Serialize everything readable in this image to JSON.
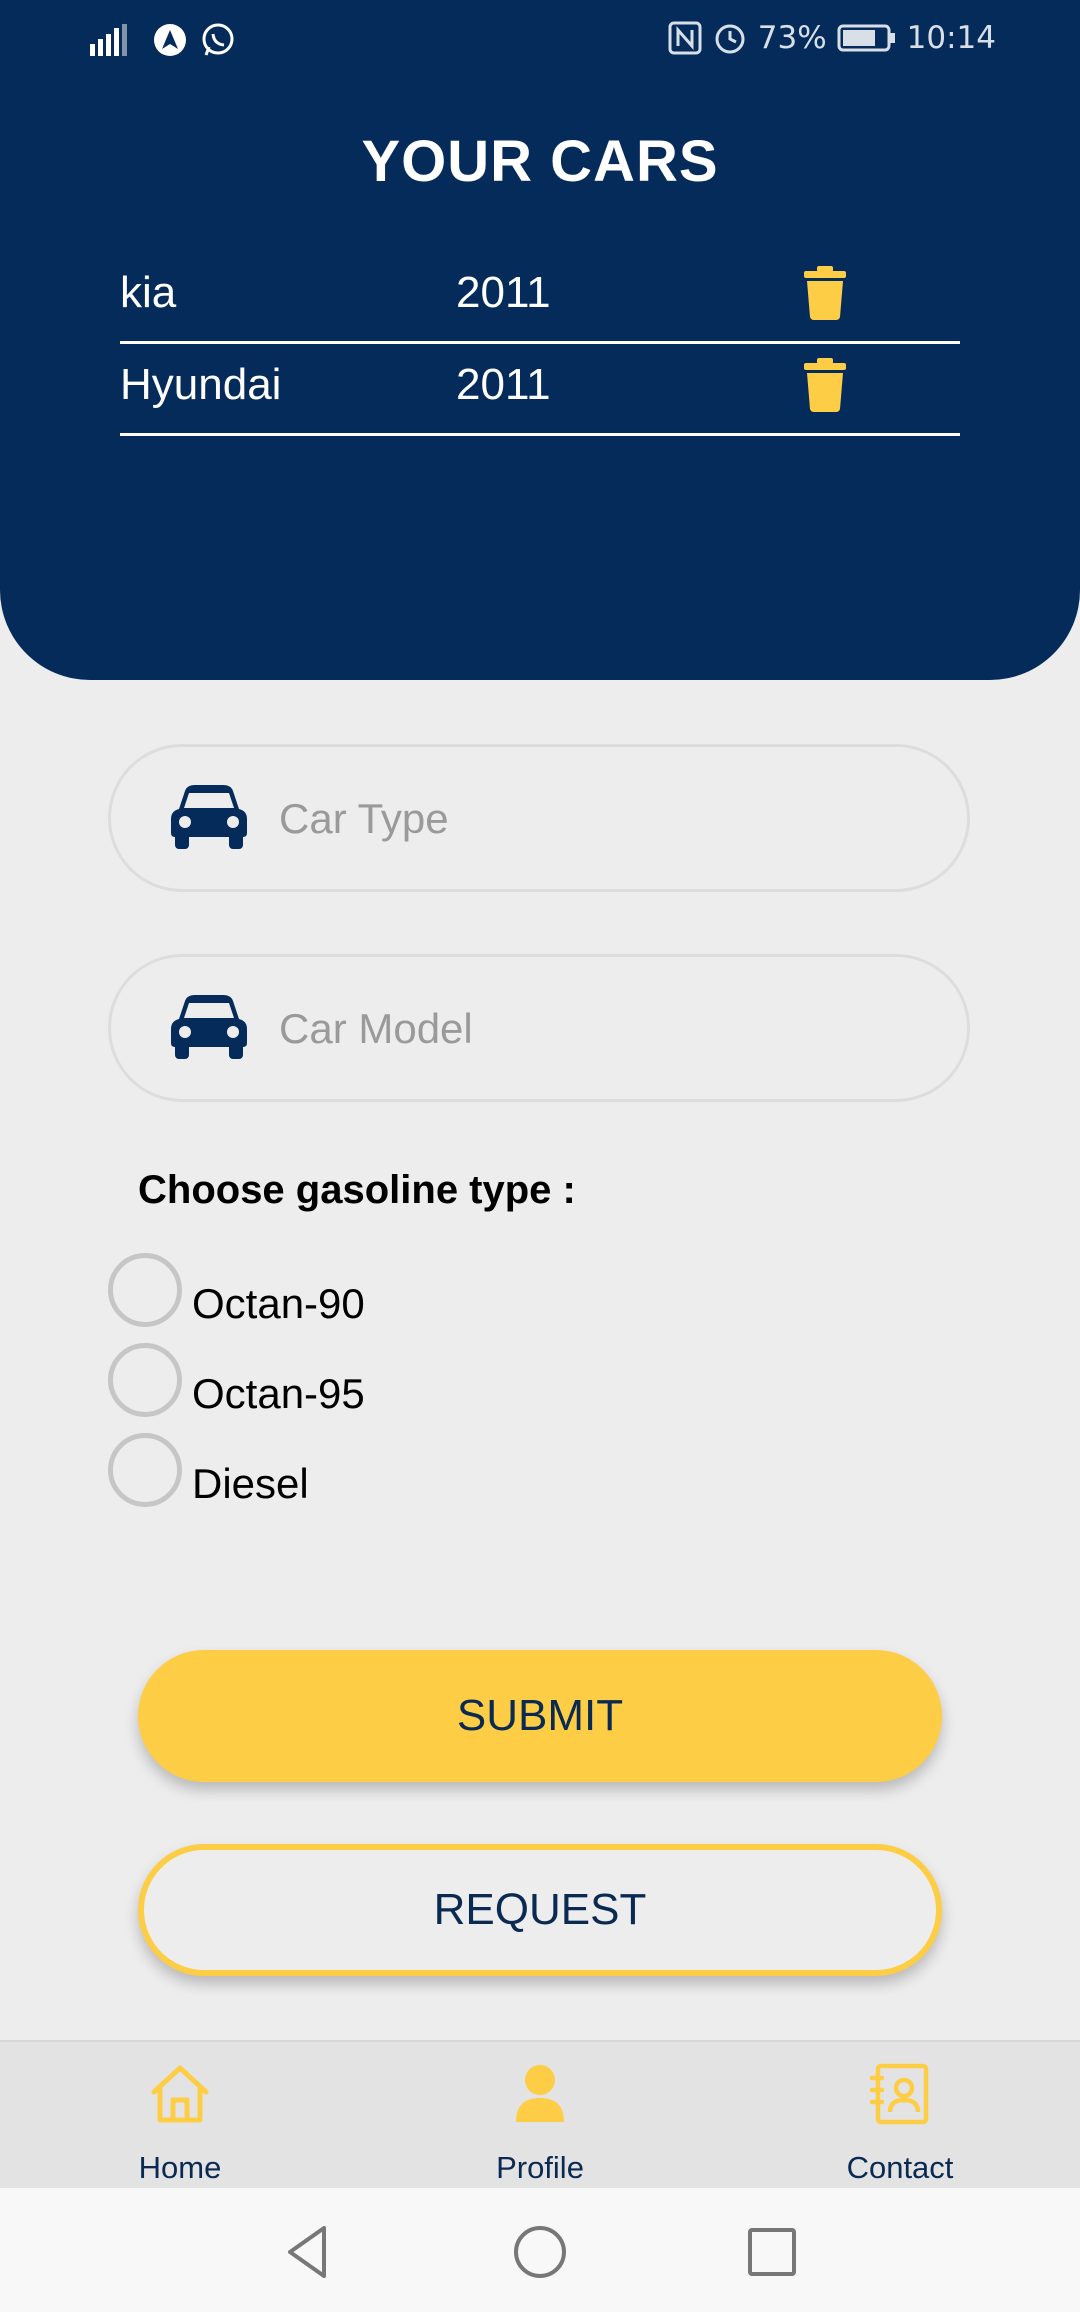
{
  "status_bar": {
    "battery": "73%",
    "time": "10:14"
  },
  "header": {
    "title": "YOUR CARS"
  },
  "cars": [
    {
      "name": "kia",
      "year": "2011"
    },
    {
      "name": "Hyundai",
      "year": "2011"
    }
  ],
  "form": {
    "car_type_placeholder": "Car Type",
    "car_model_placeholder": "Car Model",
    "gasoline_label": "Choose gasoline type :",
    "gasoline_options": [
      "Octan-90",
      "Octan-95",
      "Diesel"
    ],
    "submit_label": "SUBMIT",
    "request_label": "REQUEST"
  },
  "bottom_nav": {
    "items": [
      {
        "label": "Home",
        "icon": "home-icon"
      },
      {
        "label": "Profile",
        "icon": "person-icon"
      },
      {
        "label": "Contact",
        "icon": "contact-book-icon"
      }
    ]
  },
  "colors": {
    "primary": "#042b5a",
    "accent": "#fdcd46",
    "background": "#ededee"
  }
}
